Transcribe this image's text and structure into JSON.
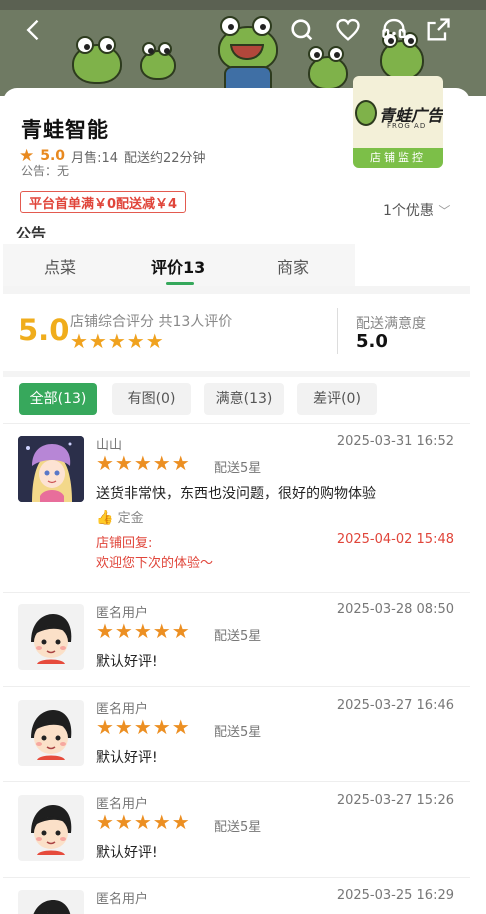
{
  "store": {
    "name": "青蛙智能",
    "rating": "5.0",
    "monthly_sales": "月售:14",
    "delivery_time": "配送约22分钟",
    "notice": "公告：无",
    "promo": "平台首单满￥0配送减￥4",
    "coupon": "1个优惠",
    "logo_text": "青蛙广告",
    "logo_sub": "FROG AD",
    "logo_bar": "店铺监控"
  },
  "notice_heading": "公告",
  "tabs": [
    {
      "label": "点菜"
    },
    {
      "label": "评价13"
    },
    {
      "label": "商家"
    }
  ],
  "score": {
    "value": "5.0",
    "label": "店铺综合评分 共13人评价",
    "stars": "★★★★★",
    "delivery_label": "配送满意度",
    "delivery_value": "5.0"
  },
  "filters": [
    {
      "label": "全部(13)"
    },
    {
      "label": "有图(0)"
    },
    {
      "label": "满意(13)"
    },
    {
      "label": "差评(0)"
    }
  ],
  "reviews": [
    {
      "user": "山山",
      "date": "2025-03-31 16:52",
      "stars": "★★★★★",
      "delivery": "配送5星",
      "text": "送货非常快，东西也没问题，很好的购物体验",
      "tag": "定金",
      "reply_label": "店铺回复:",
      "reply_date": "2025-04-02 15:48",
      "reply_text": "欢迎您下次的体验～"
    },
    {
      "user": "匿名用户",
      "date": "2025-03-28 08:50",
      "stars": "★★★★★",
      "delivery": "配送5星",
      "text": "默认好评!"
    },
    {
      "user": "匿名用户",
      "date": "2025-03-27 16:46",
      "stars": "★★★★★",
      "delivery": "配送5星",
      "text": "默认好评!"
    },
    {
      "user": "匿名用户",
      "date": "2025-03-27 15:26",
      "stars": "★★★★★",
      "delivery": "配送5星",
      "text": "默认好评!"
    },
    {
      "user": "匿名用户",
      "date": "2025-03-25 16:29"
    }
  ],
  "icons": {
    "back": "chevron-left-icon",
    "search": "search-icon",
    "favorite": "heart-icon",
    "service": "headset-icon",
    "share": "share-icon"
  },
  "colors": {
    "accent_green": "#37a85c",
    "star_orange": "#ec8f22",
    "promo_red": "#e0453a",
    "score_yellow": "#f0ad1c"
  }
}
